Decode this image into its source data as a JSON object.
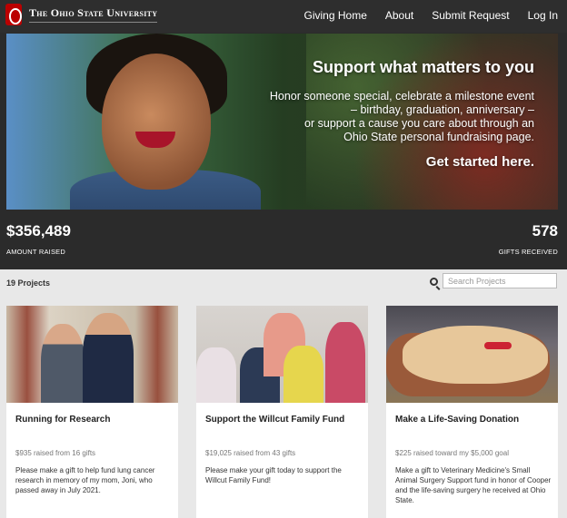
{
  "header": {
    "logo_text": "The Ohio State University",
    "nav": [
      "Giving Home",
      "About",
      "Submit Request",
      "Log In"
    ]
  },
  "hero": {
    "title": "Support what matters to you",
    "line1": "Honor someone special, celebrate a milestone event",
    "line2": "– birthday, graduation, anniversary –",
    "line3": "or support a cause you care about through an",
    "line4": "Ohio State personal fundraising page.",
    "cta": "Get started here."
  },
  "stats": {
    "amount_value": "$356,489",
    "amount_label": "AMOUNT RAISED",
    "gifts_value": "578",
    "gifts_label": "GIFTS RECEIVED"
  },
  "projects": {
    "count_label": "19 Projects",
    "search_placeholder": "Search Projects"
  },
  "cards": [
    {
      "title": "Running for Research",
      "raised": "$935 raised from 16 gifts",
      "description": "Please make a gift to help fund lung cancer research in memory of my mom, Joni, who passed away in July 2021."
    },
    {
      "title": "Support the Willcut Family Fund",
      "raised": "$19,025 raised from 43 gifts",
      "description": "Please make your gift today to support the Willcut Family Fund!"
    },
    {
      "title": "Make a Life-Saving Donation",
      "raised": "$225 raised toward my $5,000 goal",
      "description": "Make a gift to Veterinary Medicine's Small Animal Surgery Support fund in honor of Cooper and the life-saving surgery he received at Ohio State."
    }
  ],
  "colors": {
    "brand_red": "#bb0000",
    "dark_bg": "#2b2b2b",
    "light_bg": "#e8e8e8"
  }
}
